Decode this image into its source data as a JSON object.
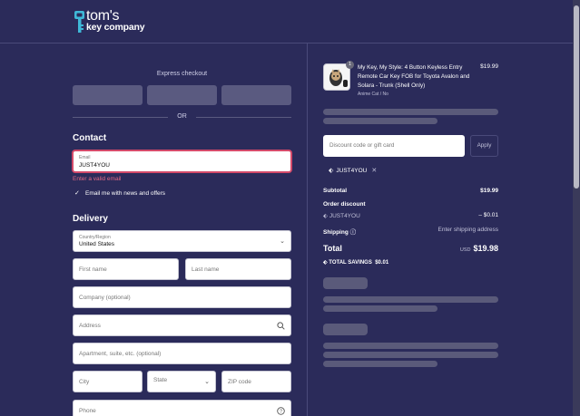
{
  "brand": {
    "line1": "tom's",
    "line2": "key company"
  },
  "express": {
    "label": "Express checkout",
    "or": "OR"
  },
  "contact": {
    "title": "Contact",
    "email_label": "Email",
    "email_value": "JUST4YOU",
    "email_error": "Enter a valid email",
    "newsletter_label": "Email me with news and offers"
  },
  "delivery": {
    "title": "Delivery",
    "country_label": "Country/Region",
    "country_value": "United States",
    "first_name_placeholder": "First name",
    "last_name_placeholder": "Last name",
    "company_placeholder": "Company (optional)",
    "address_placeholder": "Address",
    "apartment_placeholder": "Apartment, suite, etc. (optional)",
    "city_placeholder": "City",
    "state_label": "State",
    "zip_placeholder": "ZIP code",
    "phone_placeholder": "Phone"
  },
  "order": {
    "product_qty": "1",
    "product_title": "My Key, My Style: 4 Button Keyless Entry Remote Car Key FOB for Toyota Avalon and Solara - Trunk (Shell Only)",
    "product_variant": "Anime Cat / No",
    "product_price": "$19.99",
    "discount_placeholder": "Discount code or gift card",
    "apply_label": "Apply",
    "applied_code": "JUST4YOU",
    "subtotal_label": "Subtotal",
    "subtotal_value": "$19.99",
    "order_discount_label": "Order discount",
    "discount_code": "JUST4YOU",
    "discount_value": "– $0.01",
    "shipping_label": "Shipping",
    "shipping_value": "Enter shipping address",
    "total_label": "Total",
    "total_currency": "USD",
    "total_value": "$19.98",
    "savings_label": "TOTAL SAVINGS",
    "savings_value": "$0.01"
  },
  "colors": {
    "background": "#2b2b5a",
    "accent_logo": "#3fb8d8",
    "error": "#e46a84"
  },
  "icons": {
    "logo": "key-icon",
    "check": "checkmark-icon",
    "chevron": "chevron-down-icon",
    "search": "search-icon",
    "help": "question-circle-icon",
    "tag": "tag-icon",
    "close": "close-icon"
  }
}
